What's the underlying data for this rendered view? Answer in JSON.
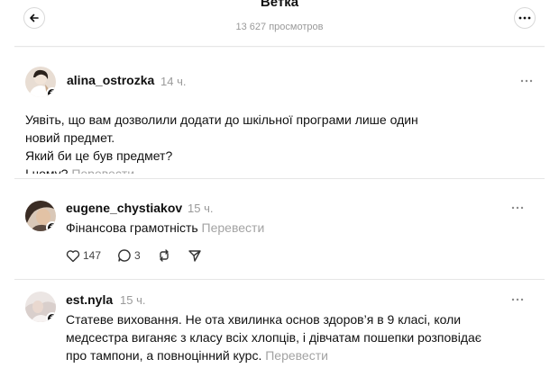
{
  "header": {
    "title": "Ветка",
    "views": "13 627 просмотров"
  },
  "main_post": {
    "username": "alina_ostrozka",
    "time": "14 ч.",
    "lines": [
      "Уявіть, що вам дозволили додати до шкільної програми лише один",
      "новий предмет.",
      "Який би це був предмет?",
      "І чому?"
    ],
    "translate": "Перевести"
  },
  "replies": [
    {
      "username": "eugene_chystiakov",
      "time": "15 ч.",
      "text": "Фінансова грамотність",
      "translate": "Перевести",
      "likes": "147",
      "comments": "3"
    },
    {
      "username": "est.nyla",
      "time": "15 ч.",
      "lines": [
        "Статеве виховання. Не ота хвилинка основ здоров’я в 9 класі, коли",
        "медсестра виганяє з класу всіх хлопців, і дівчатам пошепки розповідає",
        "про тампони, а повноцінний курс."
      ],
      "translate": "Перевести"
    }
  ],
  "icons": {
    "back": "arrow-left-icon",
    "more": "more-icon",
    "like": "heart-icon",
    "comment": "comment-icon",
    "repost": "repost-icon",
    "share": "share-icon"
  },
  "colors": {
    "text": "#101010",
    "muted": "#9a9a9a",
    "divider": "#e6e6e6"
  }
}
